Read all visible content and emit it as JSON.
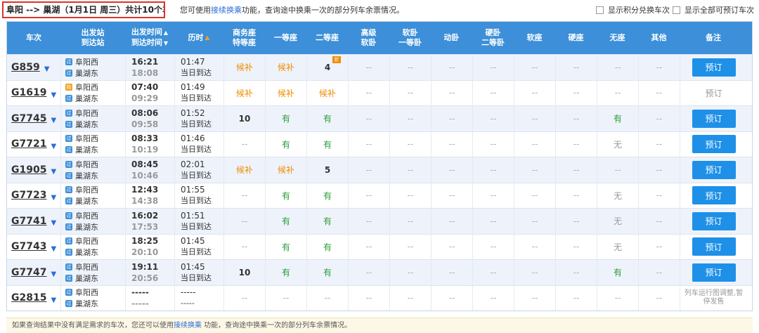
{
  "top": {
    "route": "阜阳 --> 巢湖（1月1日 周三）共计10个车次",
    "notice_before": "您可使用",
    "notice_link": "接续换乘",
    "notice_after": "功能，查询途中换乘一次的部分列车余票情况。",
    "opt_points": "显示积分兑换车次",
    "opt_all": "显示全部可预订车次"
  },
  "headers": {
    "train": "车次",
    "station_1": "出发站",
    "station_2": "到达站",
    "time_1": "出发时间",
    "time_2": "到达时间",
    "duration": "历时",
    "business_1": "商务座",
    "business_2": "特等座",
    "first": "一等座",
    "second": "二等座",
    "hisoft_1": "高级",
    "hisoft_2": "软卧",
    "softsleep_1": "软卧",
    "softsleep_2": "一等卧",
    "dongwo": "动卧",
    "hardsleep_1": "硬卧",
    "hardsleep_2": "二等卧",
    "softseat": "软座",
    "hardseat": "硬座",
    "noseat": "无座",
    "other": "其他",
    "note": "备注"
  },
  "icons": {
    "sort_up": "sort-asc-icon",
    "sort_down": "sort-desc-icon",
    "chevron": "chevron-down-icon",
    "start_station": "start-station-icon",
    "pass_station": "pass-station-icon"
  },
  "rows": [
    {
      "train": "G859",
      "from": "阜阳西",
      "to": "巢湖东",
      "dep": "16:21",
      "arr": "18:08",
      "dur": "01:47",
      "day": "当日到达",
      "seats": [
        "候补",
        "候补",
        "4",
        "--",
        "--",
        "--",
        "--",
        "--",
        "--",
        "--",
        "--"
      ],
      "book": "预订",
      "bookable": true,
      "mini_tag": true
    },
    {
      "train": "G1619",
      "from": "阜阳西",
      "to": "巢湖东",
      "dep": "07:40",
      "arr": "09:29",
      "dur": "01:49",
      "day": "当日到达",
      "start_station": true,
      "seats": [
        "候补",
        "候补",
        "候补",
        "--",
        "--",
        "--",
        "--",
        "--",
        "--",
        "--",
        "--"
      ],
      "book": "预订",
      "bookable": false
    },
    {
      "train": "G7745",
      "from": "阜阳西",
      "to": "巢湖东",
      "dep": "08:06",
      "arr": "09:58",
      "dur": "01:52",
      "day": "当日到达",
      "seats": [
        "10",
        "有",
        "有",
        "--",
        "--",
        "--",
        "--",
        "--",
        "--",
        "有",
        "--"
      ],
      "book": "预订",
      "bookable": true
    },
    {
      "train": "G7721",
      "from": "阜阳西",
      "to": "巢湖东",
      "dep": "08:33",
      "arr": "10:19",
      "dur": "01:46",
      "day": "当日到达",
      "seats": [
        "--",
        "有",
        "有",
        "--",
        "--",
        "--",
        "--",
        "--",
        "--",
        "无",
        "--"
      ],
      "book": "预订",
      "bookable": true
    },
    {
      "train": "G1905",
      "from": "阜阳西",
      "to": "巢湖东",
      "dep": "08:45",
      "arr": "10:46",
      "dur": "02:01",
      "day": "当日到达",
      "seats": [
        "候补",
        "候补",
        "5",
        "--",
        "--",
        "--",
        "--",
        "--",
        "--",
        "--",
        "--"
      ],
      "book": "预订",
      "bookable": true
    },
    {
      "train": "G7723",
      "from": "阜阳西",
      "to": "巢湖东",
      "dep": "12:43",
      "arr": "14:38",
      "dur": "01:55",
      "day": "当日到达",
      "seats": [
        "--",
        "有",
        "有",
        "--",
        "--",
        "--",
        "--",
        "--",
        "--",
        "无",
        "--"
      ],
      "book": "预订",
      "bookable": true
    },
    {
      "train": "G7741",
      "from": "阜阳西",
      "to": "巢湖东",
      "dep": "16:02",
      "arr": "17:53",
      "dur": "01:51",
      "day": "当日到达",
      "seats": [
        "--",
        "有",
        "有",
        "--",
        "--",
        "--",
        "--",
        "--",
        "--",
        "无",
        "--"
      ],
      "book": "预订",
      "bookable": true
    },
    {
      "train": "G7743",
      "from": "阜阳西",
      "to": "巢湖东",
      "dep": "18:25",
      "arr": "20:10",
      "dur": "01:45",
      "day": "当日到达",
      "seats": [
        "--",
        "有",
        "有",
        "--",
        "--",
        "--",
        "--",
        "--",
        "--",
        "无",
        "--"
      ],
      "book": "预订",
      "bookable": true
    },
    {
      "train": "G7747",
      "from": "阜阳西",
      "to": "巢湖东",
      "dep": "19:11",
      "arr": "20:56",
      "dur": "01:45",
      "day": "当日到达",
      "seats": [
        "10",
        "有",
        "有",
        "--",
        "--",
        "--",
        "--",
        "--",
        "--",
        "有",
        "--"
      ],
      "book": "预订",
      "bookable": true
    },
    {
      "train": "G2815",
      "from": "阜阳西",
      "to": "巢湖东",
      "dep": "-----",
      "arr": "-----",
      "dur": "-----",
      "day": "-----",
      "seats": [
        "--",
        "--",
        "--",
        "--",
        "--",
        "--",
        "--",
        "--",
        "--",
        "--",
        "--"
      ],
      "book": "",
      "bookable": false,
      "note": "列车运行图调整,暂停发售"
    }
  ],
  "footer": {
    "before": "如果查询结果中没有满足需求的车次，您还可以使用",
    "link": "接续换乘",
    "after": " 功能，查询途中换乘一次的部分列车余票情况。"
  },
  "colors": {
    "header_bg": "#3c8fd8",
    "book_button": "#1e90e8",
    "waitlist": "#f08c00",
    "available": "#2a9d39",
    "route_border": "#d9352b"
  }
}
